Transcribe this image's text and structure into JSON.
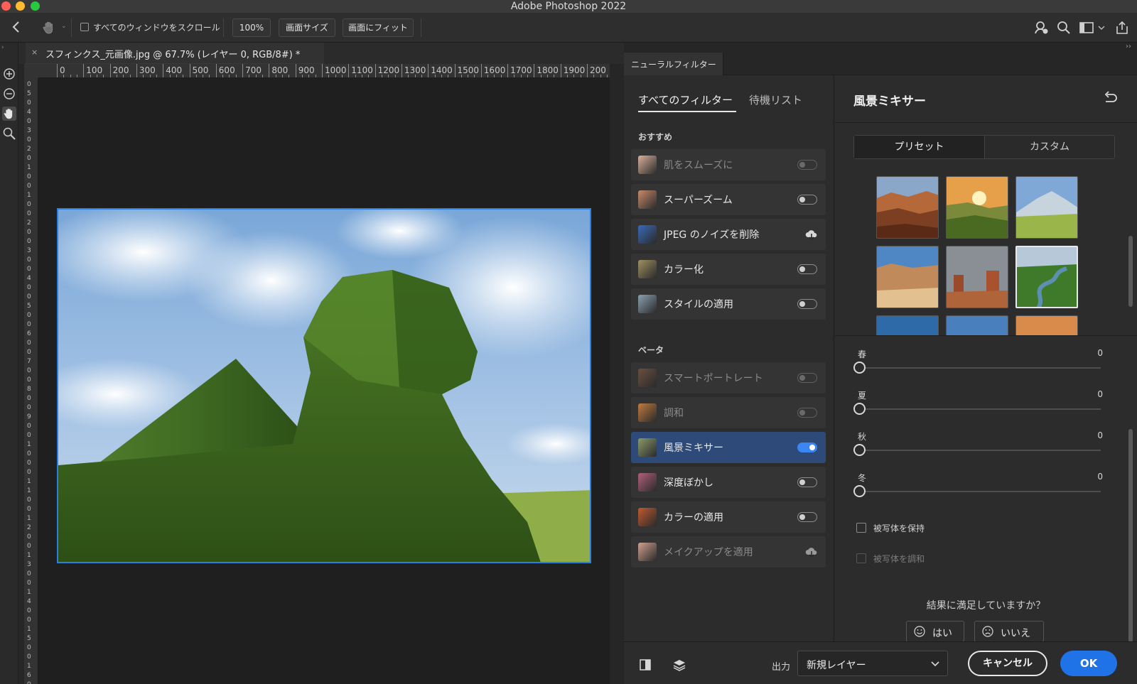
{
  "app": {
    "window_title": "Adobe Photoshop 2022"
  },
  "options_bar": {
    "scroll_all_label": "すべてのウィンドウをスクロール",
    "zoom_100": "100%",
    "fit_screen_size": "画面サイズ",
    "fill_screen": "画面にフィット"
  },
  "document": {
    "tab_title": "スフィンクス_元画像.jpg @ 67.7% (レイヤー 0, RGB/8#) *",
    "close_glyph": "×"
  },
  "ruler": {
    "top_labels": [
      "0",
      "100",
      "200",
      "300",
      "400",
      "500",
      "600",
      "700",
      "800",
      "900",
      "1000",
      "1100",
      "1200",
      "1300",
      "1400",
      "1500",
      "1600",
      "1700",
      "1800",
      "1900",
      "200"
    ],
    "left_labels": [
      "0",
      "5",
      "0",
      "4",
      "0",
      "3",
      "0",
      "2",
      "0",
      "1",
      "0",
      "0",
      "1",
      "0",
      "0",
      "2",
      "0",
      "0",
      "3",
      "0",
      "0",
      "4",
      "0",
      "0",
      "5",
      "0",
      "0",
      "6",
      "0",
      "0",
      "7",
      "0",
      "0",
      "8",
      "0",
      "0",
      "9",
      "0",
      "0",
      "1",
      "0",
      "0",
      "0",
      "1",
      "1",
      "0",
      "0",
      "1",
      "2",
      "0",
      "0",
      "1",
      "3",
      "0",
      "0",
      "1",
      "4",
      "0",
      "0",
      "1",
      "5",
      "0",
      "0",
      "1",
      "6",
      "0"
    ]
  },
  "neural_filters": {
    "panel_tab": "ニューラルフィルター",
    "collapse_glyph": "››",
    "tabs": {
      "all": "すべてのフィルター",
      "waitlist": "待機リスト"
    },
    "sections": {
      "featured": {
        "title": "おすすめ",
        "items": [
          {
            "label": "肌をスムーズに",
            "state": "off",
            "dim": true
          },
          {
            "label": "スーパーズーム",
            "state": "off",
            "dim": false
          },
          {
            "label": "JPEG のノイズを削除",
            "state": "cloud",
            "dim": false
          },
          {
            "label": "カラー化",
            "state": "off",
            "dim": false
          },
          {
            "label": "スタイルの適用",
            "state": "off",
            "dim": false
          }
        ]
      },
      "beta": {
        "title": "ベータ",
        "items": [
          {
            "label": "スマートポートレート",
            "state": "off",
            "dim": true
          },
          {
            "label": "調和",
            "state": "off",
            "dim": true
          },
          {
            "label": "風景ミキサー",
            "state": "on",
            "dim": false
          },
          {
            "label": "深度ぼかし",
            "state": "off",
            "dim": false
          },
          {
            "label": "カラーの適用",
            "state": "off",
            "dim": false
          },
          {
            "label": "メイクアップを適用",
            "state": "cloud",
            "dim": true
          }
        ]
      }
    },
    "detail": {
      "title": "風景ミキサー",
      "segment": {
        "preset": "プリセット",
        "custom": "カスタム"
      },
      "sliders": [
        {
          "label": "春",
          "value": "0"
        },
        {
          "label": "夏",
          "value": "0"
        },
        {
          "label": "秋",
          "value": "0"
        },
        {
          "label": "冬",
          "value": "0"
        }
      ],
      "checkboxes": [
        {
          "label": "被写体を保持",
          "dim": false
        },
        {
          "label": "被写体を調和",
          "dim": true
        }
      ],
      "feedback": {
        "question": "結果に満足していますか？",
        "yes": "はい",
        "no": "いいえ"
      }
    },
    "footer": {
      "output_label": "出力",
      "output_value": "新規レイヤー",
      "cancel": "キャンセル",
      "ok": "OK"
    }
  }
}
